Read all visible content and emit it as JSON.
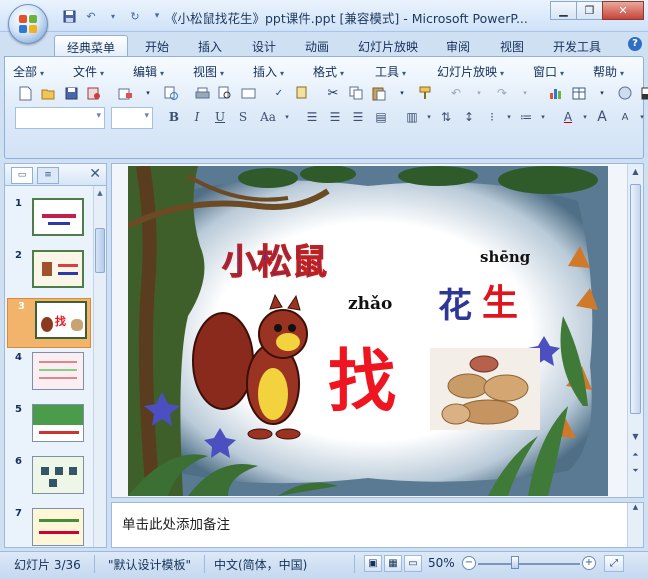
{
  "titlebar": {
    "title": "《小松鼠找花生》ppt课件.ppt [兼容模式] - Microsoft PowerP..."
  },
  "tabs": [
    {
      "label": "经典菜单",
      "active": true
    },
    {
      "label": "开始"
    },
    {
      "label": "插入"
    },
    {
      "label": "设计"
    },
    {
      "label": "动画"
    },
    {
      "label": "幻灯片放映"
    },
    {
      "label": "审阅"
    },
    {
      "label": "视图"
    },
    {
      "label": "开发工具"
    }
  ],
  "menu": [
    "全部",
    "文件",
    "编辑",
    "视图",
    "插入",
    "格式",
    "工具",
    "幻灯片放映",
    "窗口",
    "帮助"
  ],
  "slides": [
    {
      "num": "1"
    },
    {
      "num": "2"
    },
    {
      "num": "3",
      "selected": true
    },
    {
      "num": "4"
    },
    {
      "num": "5"
    },
    {
      "num": "6"
    },
    {
      "num": "7"
    }
  ],
  "slide": {
    "title": "小松鼠",
    "pinyin_zhao": "zhǎo",
    "zhao": "找",
    "pinyin_sheng": "shēng",
    "hua": "花",
    "sheng": "生"
  },
  "notes": {
    "placeholder": "单击此处添加备注"
  },
  "status": {
    "slide_info": "幻灯片 3/36",
    "template": "\"默认设计模板\"",
    "language": "中文(简体，中国)",
    "zoom": "50%",
    "zoom_fraction": 0.36
  },
  "colors": {
    "ribbon_bg": "#dce9f8",
    "accent": "#2b3aa8",
    "red": "#ee1520",
    "selected_thumb": "#f2b36b"
  }
}
